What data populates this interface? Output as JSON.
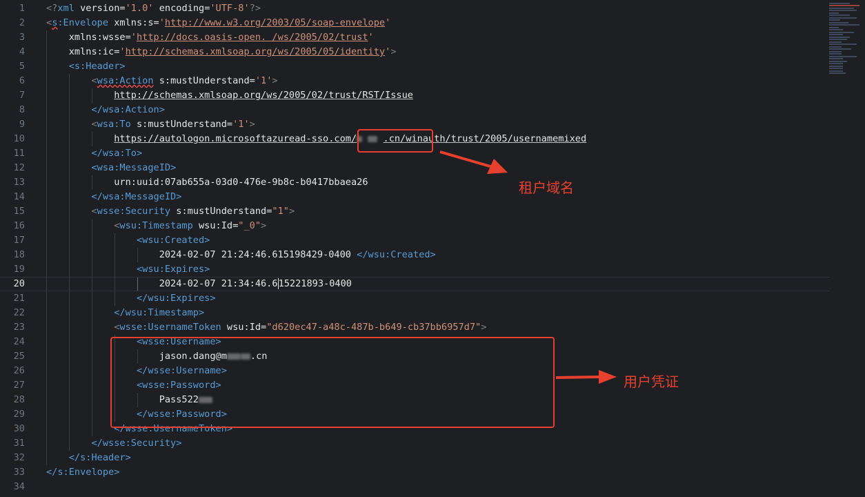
{
  "gutter": {
    "line_numbers": [
      "1",
      "2",
      "3",
      "4",
      "5",
      "6",
      "7",
      "8",
      "9",
      "10",
      "11",
      "12",
      "13",
      "14",
      "15",
      "16",
      "17",
      "18",
      "19",
      "20",
      "21",
      "22",
      "23",
      "24",
      "25",
      "26",
      "27",
      "28",
      "29",
      "30",
      "31",
      "32",
      "33",
      "34"
    ],
    "active_line": "20"
  },
  "code": {
    "l1": {
      "a": "<?",
      "b": "xml",
      "c": " version=",
      "d": "'1.0'",
      "e": " encoding=",
      "f": "'UTF-8'",
      "g": "?>"
    },
    "l2": {
      "lt": "<",
      "tag_prefix": "s",
      "tag": ":Envelope",
      "attr": " xmlns:s=",
      "q1": "'",
      "url": "http://www.w3.org/2003/05/soap-envelope",
      "q2": "'"
    },
    "l3": {
      "attr": "xmlns:wsse=",
      "q1": "'",
      "url": "http://docs.oasis-open. /ws/2005/02/trust",
      "q2": "'"
    },
    "l4": {
      "attr": "xmlns:ic=",
      "q1": "'",
      "url": "http://schemas.xmlsoap.org/ws/2005/05/identity",
      "q2": "'",
      "gt": ">"
    },
    "l5": {
      "tag": "<s:Header>"
    },
    "l6": {
      "lt": "<",
      "tag": "wsa:Action",
      "attr": " s:mustUnderstand=",
      "str": "'1'",
      "gt": ">"
    },
    "l7": {
      "url": "http://schemas.xmlsoap.org/ws/2005/02/trust/RST/Issue"
    },
    "l8": {
      "tag": "</wsa:Action>"
    },
    "l9": {
      "lt": "<",
      "tag": "wsa:To",
      "attr": " s:mustUnderstand=",
      "str": "'1'",
      "gt": ">"
    },
    "l10": {
      "url_a": "https://autologon.microsoftazuread-sso.com/",
      "url_b": ".cn/winauth/trust/2005/usernamemixed"
    },
    "l11": {
      "tag": "</wsa:To>"
    },
    "l12": {
      "tag": "<wsa:MessageID>"
    },
    "l13": {
      "text": "urn:uuid:07ab655a-03d0-476e-9b8c-b0417bbaea26"
    },
    "l14": {
      "tag": "</wsa:MessageID>"
    },
    "l15": {
      "lt": "<",
      "tag": "wsse:Security",
      "attr": " s:mustUnderstand=",
      "str": "\"1\"",
      "gt": ">"
    },
    "l16": {
      "lt": "<",
      "tag": "wsu:Timestamp",
      "attr": " wsu:Id=",
      "str": "\"_0\"",
      "gt": ">"
    },
    "l17": {
      "tag": "<wsu:Created>"
    },
    "l18": {
      "text": "2024-02-07 21:24:46.615198429-0400 ",
      "tag": "</wsu:Created>"
    },
    "l19": {
      "tag": "<wsu:Expires>"
    },
    "l20": {
      "text_a": "2024-02-07 21:34:46.6",
      "text_b": "15221893-0400"
    },
    "l21": {
      "tag": "</wsu:Expires>"
    },
    "l22": {
      "tag": "</wsu:Timestamp>"
    },
    "l23": {
      "lt": "<",
      "tag": "wsse:UsernameToken",
      "attr": " wsu:Id=",
      "str": "\"d620ec47-a48c-487b-b649-cb37bb6957d7\"",
      "gt": ">"
    },
    "l24": {
      "tag": "<wsse:Username>"
    },
    "l25": {
      "text_a": "jason.dang@m",
      "text_b": ".cn"
    },
    "l26": {
      "tag": "</wsse:Username>"
    },
    "l27": {
      "tag": "<wsse:Password>"
    },
    "l28": {
      "text": "Pass522"
    },
    "l29": {
      "tag": "</wsse:Password>"
    },
    "l30": {
      "tag": "</wsse:UsernameToken>"
    },
    "l31": {
      "tag": "</wsse:Security>"
    },
    "l32": {
      "tag": "</s:Header>"
    },
    "l33": {
      "tag": "</s:Envelope>"
    }
  },
  "annotations": {
    "tenant_domain": "租户域名",
    "user_credentials": "用户凭证"
  },
  "colors": {
    "background": "#1e1f22",
    "tag": "#569cd6",
    "string": "#ce9178",
    "annotation": "#e8402e"
  }
}
